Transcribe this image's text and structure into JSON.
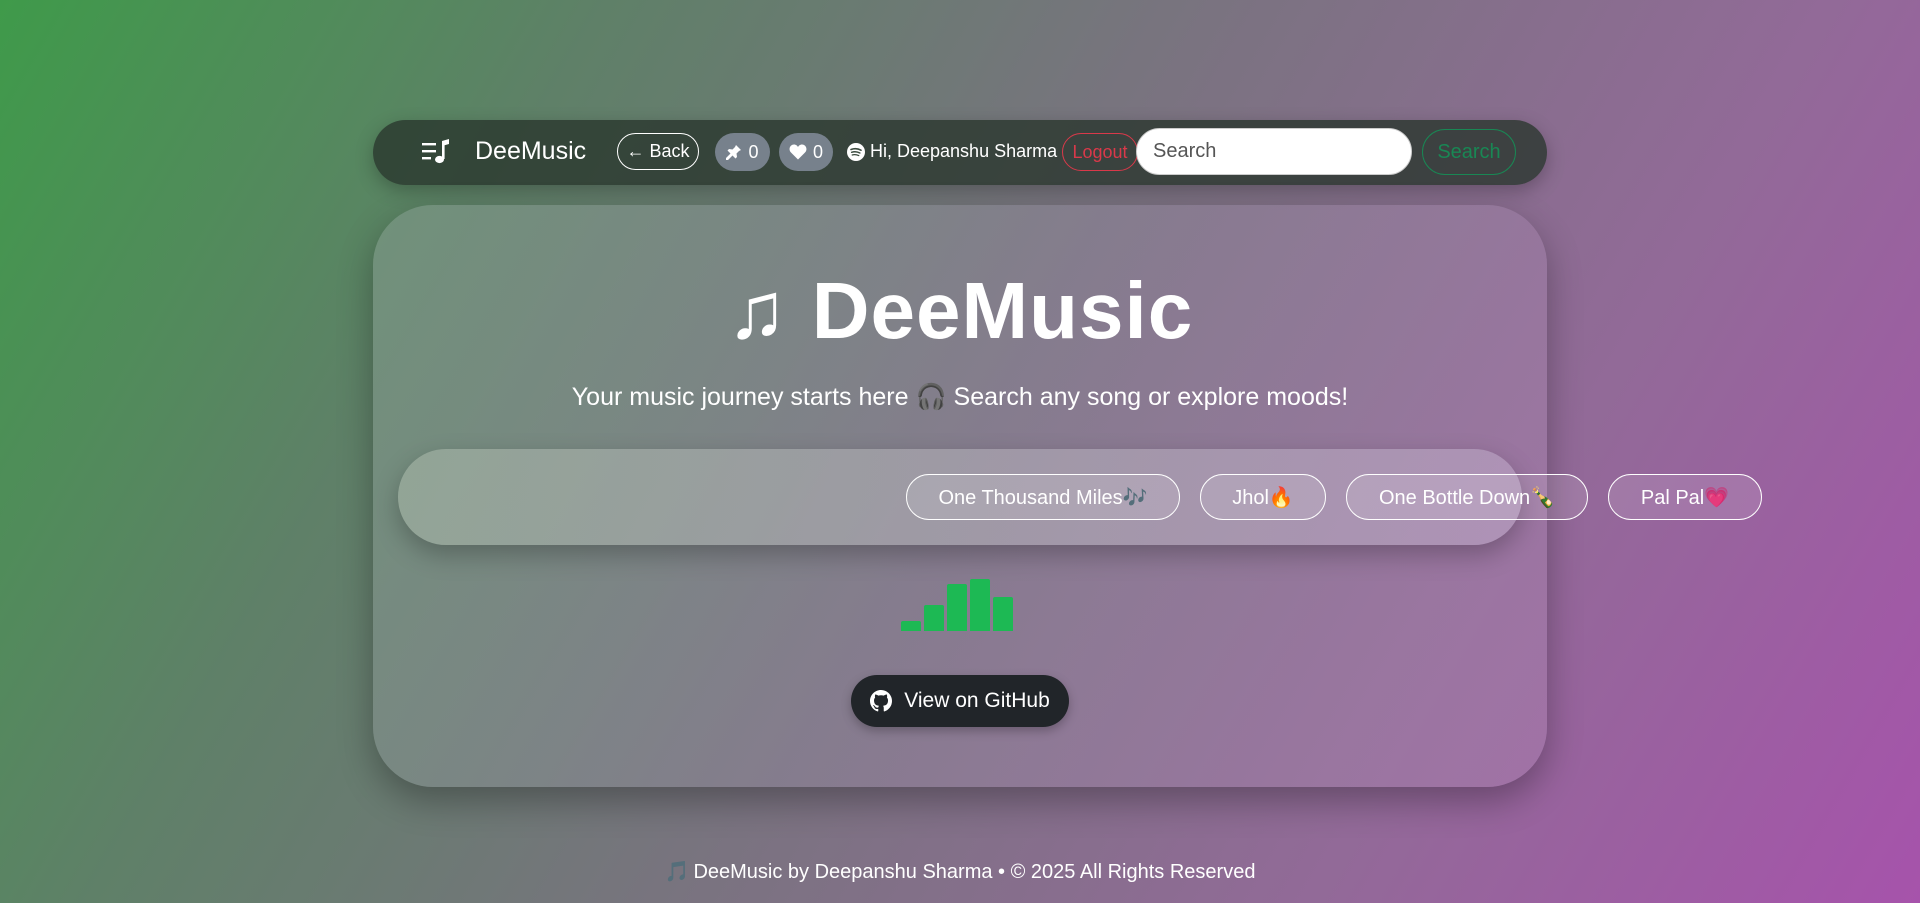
{
  "navbar": {
    "brand": "DeeMusic",
    "back_label": "Back",
    "pinned_count": "0",
    "liked_count": "0",
    "greeting": "Hi, Deepanshu Sharma",
    "logout_label": "Logout",
    "search_placeholder": "Search",
    "search_button": "Search"
  },
  "hero": {
    "note_glyph": "♫",
    "title": "DeeMusic",
    "subtitle": "Your music journey starts here 🎧 Search any song or explore moods!"
  },
  "moods": [
    {
      "label": "One Thousand Miles🎶"
    },
    {
      "label": "Jhol🔥"
    },
    {
      "label": "One Bottle Down🍾"
    },
    {
      "label": "Pal Pal💗"
    }
  ],
  "equalizer": {
    "color": "#1db954",
    "levels": [
      0.2,
      0.5,
      0.9,
      1.0,
      0.65
    ]
  },
  "github_button": "View on GitHub",
  "footer": {
    "note": "🎵",
    "text": "DeeMusic by Deepanshu Sharma • © 2025 All Rights Reserved"
  },
  "colors": {
    "logout": "#d9394a",
    "search": "#198754",
    "github_bg": "#212529"
  }
}
